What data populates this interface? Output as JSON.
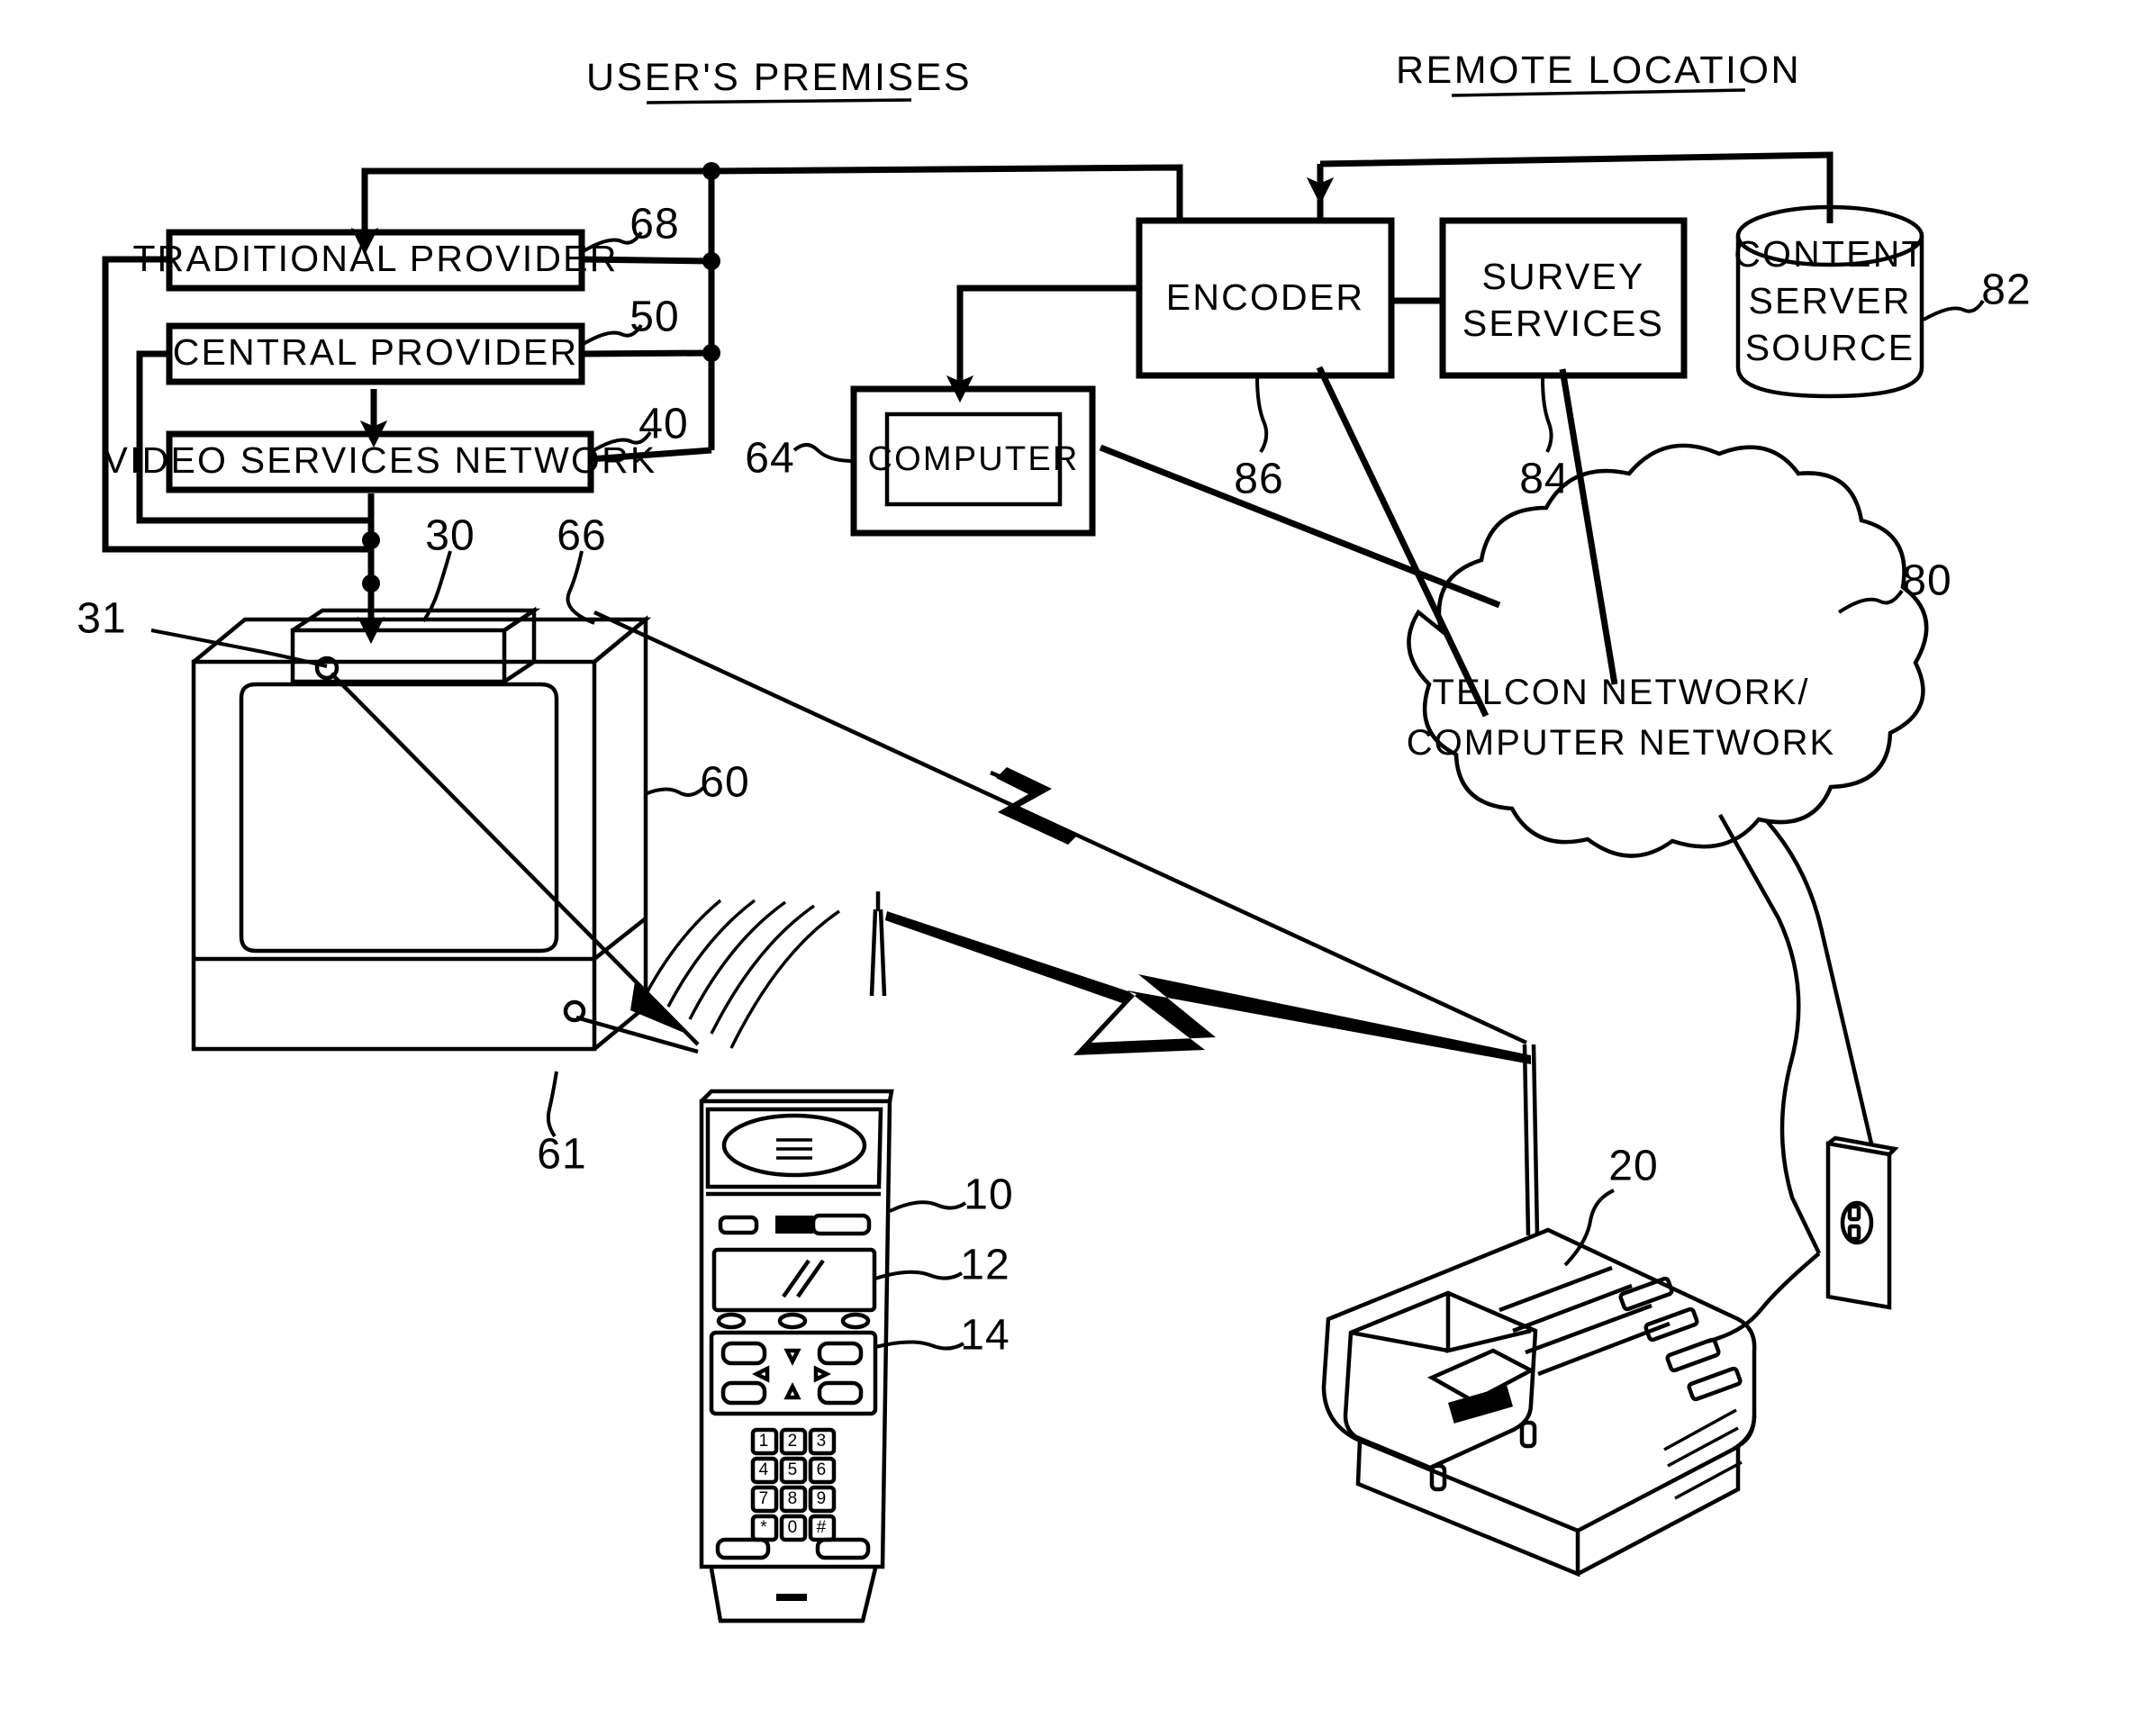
{
  "figure": {
    "type": "patent-block-diagram",
    "headers": [
      {
        "id": "users-premises",
        "label": "USER'S PREMISES"
      },
      {
        "id": "remote-location",
        "label": "REMOTE LOCATION"
      }
    ],
    "blocks": [
      {
        "id": "traditional-provider",
        "label": "TRADITIONAL PROVIDER",
        "ref": "68"
      },
      {
        "id": "central-provider",
        "label": "CENTRAL PROVIDER",
        "ref": "50"
      },
      {
        "id": "video-services-network",
        "label": "VIDEO SERVICES NETWORK",
        "ref": "40"
      },
      {
        "id": "computer",
        "label": "COMPUTER",
        "ref": "64"
      },
      {
        "id": "encoder",
        "label": "ENCODER",
        "ref": "86"
      },
      {
        "id": "survey-services",
        "label": "SURVEY SERVICES",
        "ref": "84",
        "lines": [
          "SURVEY",
          "SERVICES"
        ]
      },
      {
        "id": "content-server-source",
        "label": "CONTENT SERVER SOURCE",
        "ref": "82",
        "lines": [
          "CONTENT",
          "SERVER",
          "SOURCE"
        ]
      },
      {
        "id": "telcon-network",
        "label": "TELCON NETWORK/ COMPUTER NETWORK",
        "ref": "80",
        "lines": [
          "TELCON NETWORK/",
          "COMPUTER NETWORK"
        ]
      }
    ],
    "reference_numerals": [
      {
        "ref": "68",
        "target": "traditional-provider"
      },
      {
        "ref": "50",
        "target": "central-provider"
      },
      {
        "ref": "40",
        "target": "video-services-network"
      },
      {
        "ref": "30",
        "target": "set-top-box"
      },
      {
        "ref": "31",
        "target": "set-top-box-sensor"
      },
      {
        "ref": "66",
        "target": "set-top-box-link"
      },
      {
        "ref": "60",
        "target": "television"
      },
      {
        "ref": "61",
        "target": "television-sensor"
      },
      {
        "ref": "64",
        "target": "computer"
      },
      {
        "ref": "86",
        "target": "encoder"
      },
      {
        "ref": "84",
        "target": "survey-services"
      },
      {
        "ref": "82",
        "target": "content-server-source"
      },
      {
        "ref": "80",
        "target": "telcon-network"
      },
      {
        "ref": "10",
        "target": "handset"
      },
      {
        "ref": "12",
        "target": "handset-display"
      },
      {
        "ref": "14",
        "target": "handset-navigation-keypad"
      },
      {
        "ref": "20",
        "target": "base-station"
      }
    ],
    "devices": [
      {
        "id": "television",
        "ref": "60",
        "kind": "crt-television"
      },
      {
        "id": "set-top-box",
        "ref": "30",
        "kind": "set-top-box"
      },
      {
        "id": "handset",
        "ref": "10",
        "kind": "wireless-handset",
        "keypad": [
          "1",
          "2",
          "3",
          "4",
          "5",
          "6",
          "7",
          "8",
          "9",
          "*",
          "0",
          "#"
        ]
      },
      {
        "id": "base-station",
        "ref": "20",
        "kind": "cradle-base-station"
      },
      {
        "id": "wall-outlet",
        "ref": "",
        "kind": "electrical-outlet"
      }
    ],
    "colors": {
      "ink": "#000000",
      "paper": "#ffffff"
    }
  }
}
